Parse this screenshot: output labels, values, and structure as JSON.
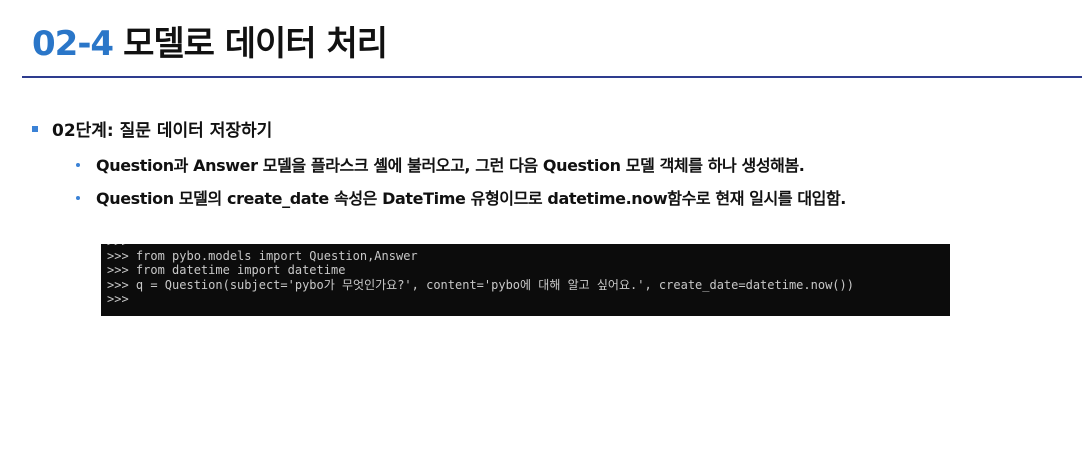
{
  "slide": {
    "number": "02-4",
    "title": "모델로 데이터 처리"
  },
  "step": {
    "heading": "02단계: 질문 데이터 저장하기",
    "bullets": [
      "Question과 Answer 모델을 플라스크 셸에 불러오고, 그런 다음 Question 모델 객체를 하나 생성해봄.",
      "Question 모델의 create_date 속성은 DateTime 유형이므로 datetime.now함수로 현재 일시를 대입함."
    ]
  },
  "terminal": {
    "lines": [
      ">>> ",
      ">>> from pybo.models import Question,Answer",
      ">>> from datetime import datetime",
      ">>> q = Question(subject='pybo가 무엇인가요?', content='pybo에 대해 알고 싶어요.', create_date=datetime.now())",
      ">>>"
    ]
  },
  "colors": {
    "accent": "#2a76c8",
    "rule": "#2e3c8e",
    "bullet": "#3b82d6",
    "terminal_bg": "#0c0c0c",
    "terminal_text": "#c8c8c8"
  }
}
